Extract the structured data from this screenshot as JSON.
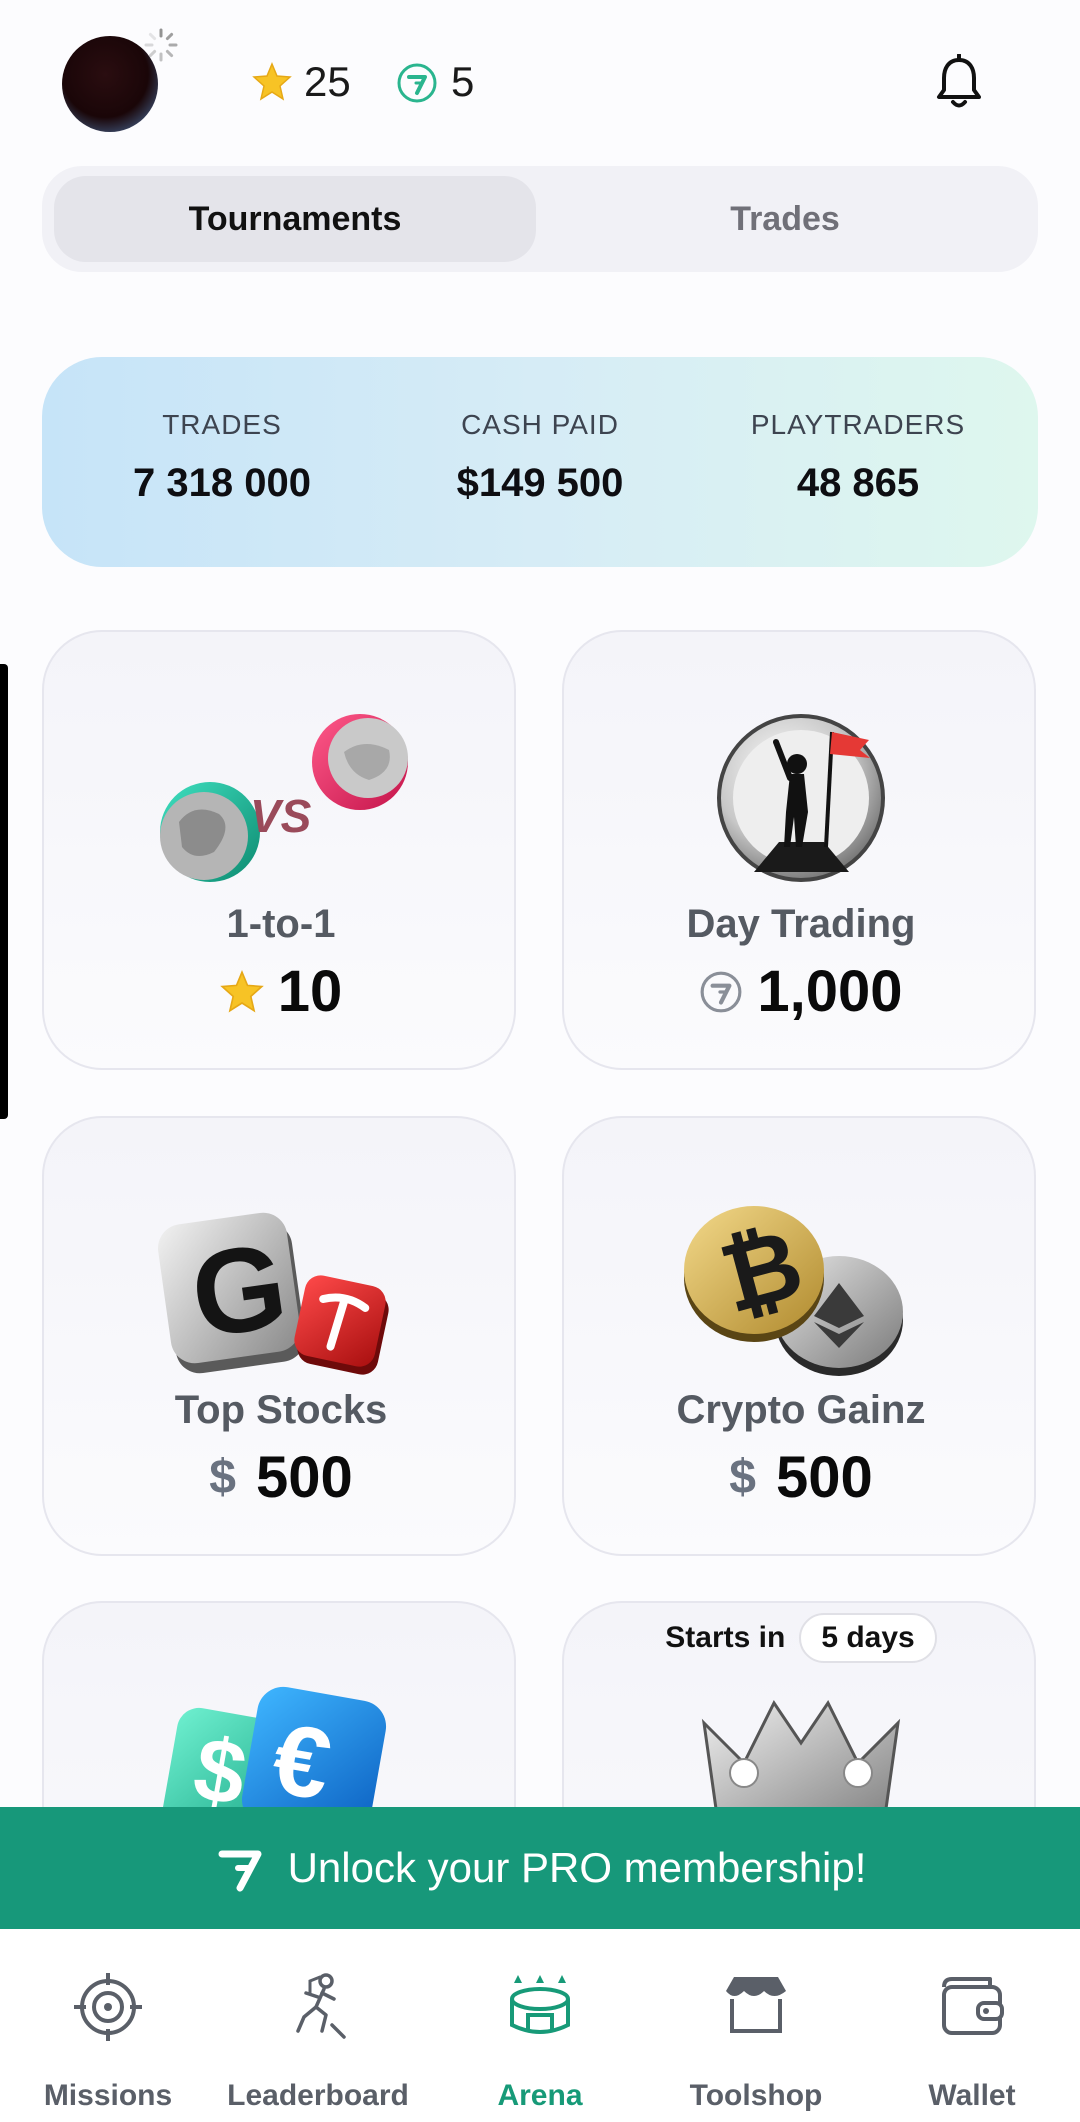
{
  "header": {
    "stars": "25",
    "coins": "5",
    "icons": {
      "avatar": "avatar",
      "star": "star-icon",
      "coin": "playtraders-coin-icon",
      "bell": "bell-icon"
    }
  },
  "tabs": {
    "tournaments": "Tournaments",
    "trades": "Trades",
    "active": "Tournaments"
  },
  "stats": [
    {
      "label": "TRADES",
      "value": "7 318 000"
    },
    {
      "label": "CASH PAID",
      "value": "$149 500"
    },
    {
      "label": "PLAYTRADERS",
      "value": "48 865"
    }
  ],
  "cards": {
    "one_to_one": {
      "title": "1-to-1",
      "price": "10",
      "currency": "star"
    },
    "day_trading": {
      "title": "Day Trading",
      "price": "1,000",
      "currency": "coin"
    },
    "top_stocks": {
      "title": "Top Stocks",
      "price": "500",
      "currency_symbol": "$"
    },
    "crypto_gainz": {
      "title": "Crypto Gainz",
      "price": "500",
      "currency_symbol": "$"
    },
    "forex": {
      "title": ""
    },
    "crown": {
      "starts_label": "Starts in",
      "starts_value": "5 days"
    }
  },
  "pro_banner": {
    "text": "Unlock your PRO membership!"
  },
  "nav": {
    "missions": "Missions",
    "leaderboard": "Leaderboard",
    "arena": "Arena",
    "toolshop": "Toolshop",
    "wallet": "Wallet",
    "active": "Arena"
  },
  "colors": {
    "accent": "#17987a",
    "active_nav": "#179a78"
  }
}
